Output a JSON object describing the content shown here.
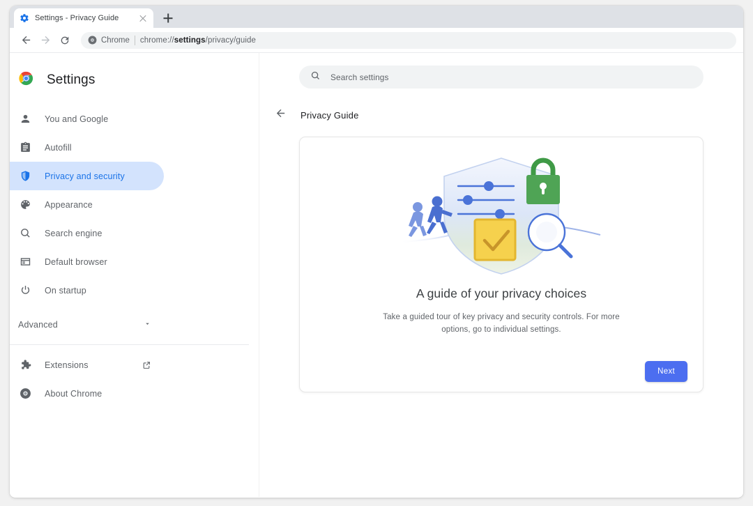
{
  "window": {
    "tab": {
      "title": "Settings - Privacy Guide",
      "favicon_icon": "settings-gear-icon",
      "close_icon": "close-icon"
    },
    "new_tab_icon": "plus-icon",
    "toolbar": {
      "back_icon": "arrow-back-icon",
      "forward_icon": "arrow-forward-icon",
      "reload_icon": "reload-icon",
      "omnibox": {
        "site_icon": "chrome-icon",
        "site_label": "Chrome",
        "url_prefix": "chrome://",
        "url_bold": "settings",
        "url_suffix": "/privacy/guide",
        "url_full": "chrome://settings/privacy/guide"
      }
    }
  },
  "sidebar": {
    "brand": {
      "logo_icon": "chrome-logo-icon",
      "title": "Settings"
    },
    "items": [
      {
        "label": "You and Google",
        "icon": "person-icon",
        "selected": false
      },
      {
        "label": "Autofill",
        "icon": "clipboard-icon",
        "selected": false
      },
      {
        "label": "Privacy and security",
        "icon": "shield-icon",
        "selected": true
      },
      {
        "label": "Appearance",
        "icon": "palette-icon",
        "selected": false
      },
      {
        "label": "Search engine",
        "icon": "search-icon",
        "selected": false
      },
      {
        "label": "Default browser",
        "icon": "browser-window-icon",
        "selected": false
      },
      {
        "label": "On startup",
        "icon": "power-icon",
        "selected": false
      }
    ],
    "advanced": {
      "label": "Advanced",
      "caret_icon": "chevron-down-icon"
    },
    "footer": [
      {
        "label": "Extensions",
        "icon": "puzzle-icon",
        "trailing_icon": "open-in-new-icon"
      },
      {
        "label": "About Chrome",
        "icon": "chrome-icon",
        "trailing_icon": ""
      }
    ]
  },
  "main": {
    "search": {
      "icon": "search-icon",
      "placeholder": "Search settings",
      "value": ""
    },
    "page_header": {
      "back_icon": "arrow-back-icon",
      "title": "Privacy Guide"
    },
    "card": {
      "illustration_name": "privacy-shield-illustration",
      "title": "A guide of your privacy choices",
      "description": "Take a guided tour of key privacy and security controls. For more options, go to individual settings.",
      "next_label": "Next"
    }
  },
  "colors": {
    "accent_blue": "#4c6ef0",
    "selected_pill": "#d3e3fd",
    "selected_text": "#1a73e8",
    "tabstrip": "#dee1e6",
    "omnibox_bg": "#f1f3f4",
    "lock_green": "#4c9a4c",
    "check_yellow": "#f2c32c"
  },
  "cursor": {
    "type": "pointer-hand-cursor"
  }
}
